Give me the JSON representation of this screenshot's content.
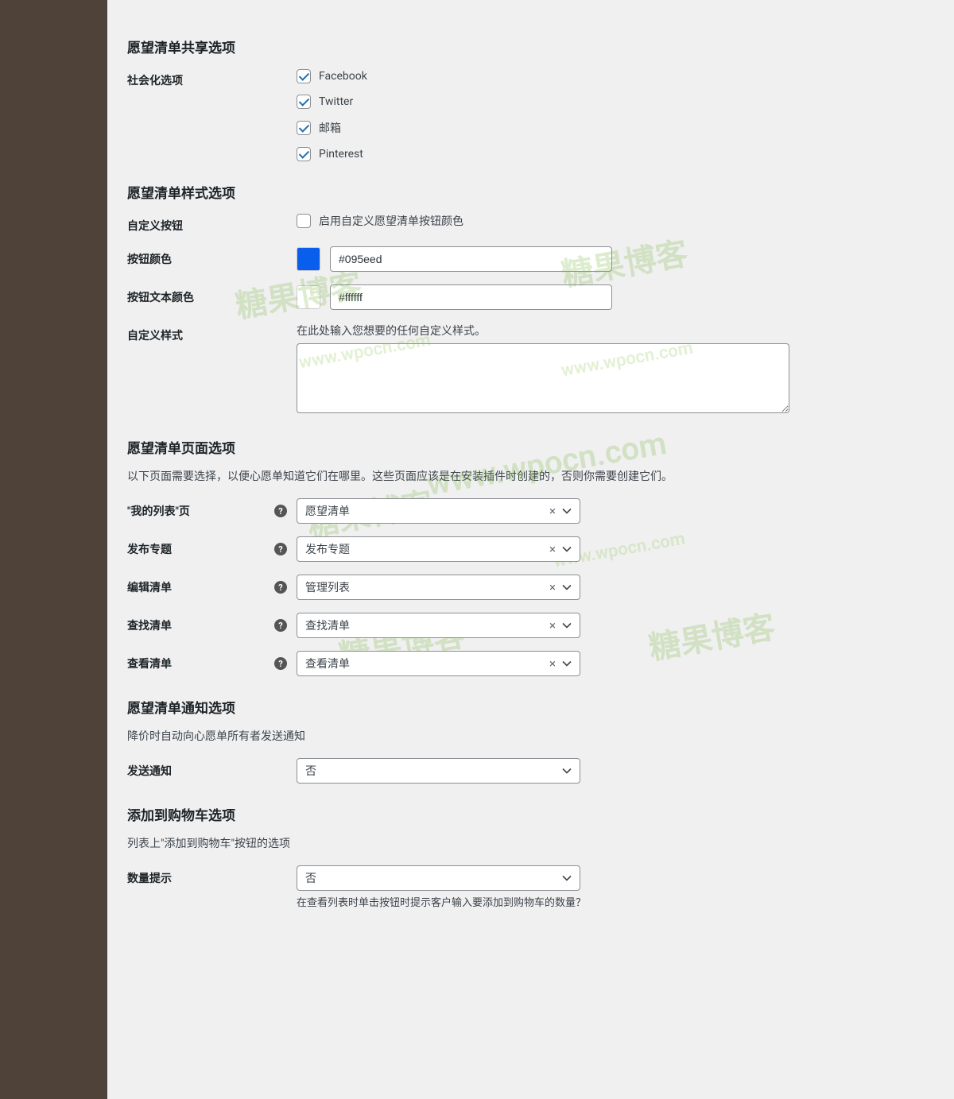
{
  "sections": {
    "share": {
      "title": "愿望清单共享选项"
    },
    "style": {
      "title": "愿望清单样式选项"
    },
    "pages": {
      "title": "愿望清单页面选项",
      "desc": "以下页面需要选择，以便心愿单知道它们在哪里。这些页面应该是在安装插件时创建的，否则你需要创建它们。"
    },
    "notify": {
      "title": "愿望清单通知选项",
      "desc": "降价时自动向心愿单所有者发送通知"
    },
    "cart": {
      "title": "添加到购物车选项",
      "desc": "列表上\"添加到购物车\"按钮的选项"
    }
  },
  "share": {
    "label": "社会化选项",
    "opts": [
      {
        "label": "Facebook",
        "checked": true
      },
      {
        "label": "Twitter",
        "checked": true
      },
      {
        "label": "邮箱",
        "checked": true
      },
      {
        "label": "Pinterest",
        "checked": true
      }
    ]
  },
  "style": {
    "custom_button": {
      "label": "自定义按钮",
      "cb_label": "启用自定义愿望清单按钮颜色",
      "checked": false
    },
    "btn_color": {
      "label": "按钮颜色",
      "hex": "#095eed"
    },
    "btn_text_color": {
      "label": "按钮文本颜色",
      "hex": "#ffffff"
    },
    "custom_css": {
      "label": "自定义样式",
      "note": "在此处输入您想要的任何自定义样式。",
      "value": ""
    }
  },
  "pages": {
    "my_lists": {
      "label": "\"我的列表\"页",
      "value": "愿望清单"
    },
    "create": {
      "label": "发布专题",
      "value": "发布专题"
    },
    "edit": {
      "label": "编辑清单",
      "value": "管理列表"
    },
    "find": {
      "label": "查找清单",
      "value": "查找清单"
    },
    "view": {
      "label": "查看清单",
      "value": "查看清单"
    }
  },
  "notify": {
    "send": {
      "label": "发送通知",
      "value": "否"
    }
  },
  "cart": {
    "qty_prompt": {
      "label": "数量提示",
      "value": "否",
      "subnote": "在查看列表时单击按钮时提示客户输入要添加到购物车的数量？"
    }
  },
  "wm": {
    "text": "糖果博客",
    "url": "www.wpocn.com"
  }
}
